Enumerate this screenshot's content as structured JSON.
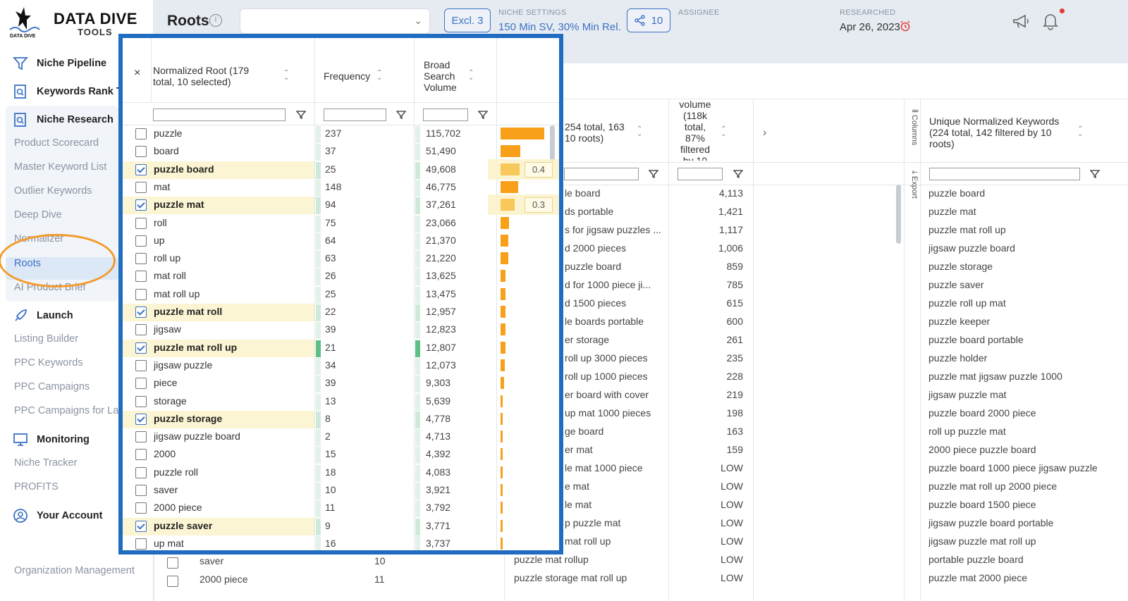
{
  "sidebar": {
    "logo_title": "DATA DIVE",
    "logo_sub": "TOOLS",
    "logo_mark": "DATA DIVE",
    "niche_pipeline": "Niche Pipeline",
    "keywords_rank": "Keywords Rank Tracker",
    "niche_research": "Niche Research",
    "research_items": [
      "Product Scorecard",
      "Master Keyword List",
      "Outlier Keywords",
      "Deep Dive",
      "Normalizer",
      "Roots",
      "AI Product Brief"
    ],
    "launch": "Launch",
    "launch_items": [
      "Listing Builder",
      "PPC Keywords",
      "PPC Campaigns",
      "PPC Campaigns for Launch"
    ],
    "monitoring": "Monitoring",
    "monitoring_items": [
      "Niche Tracker",
      "PROFITS"
    ],
    "account": "Your Account",
    "org": "Organization Management"
  },
  "topbar": {
    "title": "Roots",
    "excl": "Excl. 3",
    "niche_label": "NICHE SETTINGS",
    "niche_value": "150 Min SV, 30% Min Rel.",
    "share": "10",
    "assignee_label": "ASSIGNEE",
    "researched_label": "RESEARCHED",
    "researched_value": "Apr 26, 2023"
  },
  "colors": {
    "accent": "#3b72c4",
    "highlight": "#1f6cc0",
    "orange": "#f39a2b",
    "bar": "#f9a01b"
  },
  "kw_table": {
    "kw_header": "254 total, 163",
    "kw_header2": "10 roots)",
    "vol_header": [
      "volume",
      "(118k",
      "total,",
      "87%",
      "filtered",
      "by 10"
    ],
    "uniq_header": [
      "Unique Normalized Keywords",
      "(224 total, 142 filtered by 10",
      "roots)"
    ],
    "columns_label": "Columns",
    "export_label": "Export",
    "rows": [
      {
        "kw": "le board",
        "vol": "4,113",
        "u": "puzzle board"
      },
      {
        "kw": "ds portable",
        "vol": "1,421",
        "u": "puzzle mat"
      },
      {
        "kw": "s for jigsaw puzzles ...",
        "vol": "1,117",
        "u": "puzzle mat roll up"
      },
      {
        "kw": "d 2000 pieces",
        "vol": "1,006",
        "u": "jigsaw puzzle board"
      },
      {
        "kw": "puzzle board",
        "vol": "859",
        "u": "puzzle storage"
      },
      {
        "kw": "d for 1000 piece ji...",
        "vol": "785",
        "u": "puzzle saver"
      },
      {
        "kw": "d 1500 pieces",
        "vol": "615",
        "u": "puzzle roll up mat"
      },
      {
        "kw": "le boards portable",
        "vol": "600",
        "u": "puzzle keeper"
      },
      {
        "kw": "er storage",
        "vol": "261",
        "u": "puzzle board portable"
      },
      {
        "kw": "roll up 3000 pieces",
        "vol": "235",
        "u": "puzzle holder"
      },
      {
        "kw": "roll up 1000 pieces",
        "vol": "228",
        "u": "puzzle mat jigsaw puzzle 1000"
      },
      {
        "kw": "er board with cover",
        "vol": "219",
        "u": "jigsaw puzzle mat"
      },
      {
        "kw": "up mat 1000 pieces",
        "vol": "198",
        "u": "puzzle board 2000 piece"
      },
      {
        "kw": "ge board",
        "vol": "163",
        "u": "roll up puzzle mat"
      },
      {
        "kw": "er mat",
        "vol": "159",
        "u": "2000 piece puzzle board"
      },
      {
        "kw": "le mat 1000 piece",
        "vol": "LOW",
        "u": "puzzle board 1000 piece jigsaw puzzle"
      },
      {
        "kw": "e mat",
        "vol": "LOW",
        "u": "puzzle mat roll up 2000 piece"
      },
      {
        "kw": "le mat",
        "vol": "LOW",
        "u": "puzzle board 1500 piece"
      },
      {
        "kw": "p puzzle mat",
        "vol": "LOW",
        "u": "jigsaw puzzle board portable"
      },
      {
        "kw": "mat roll up",
        "vol": "LOW",
        "u": "jigsaw puzzle mat roll up"
      },
      {
        "kw": "puzzle mat rollup",
        "vol": "LOW",
        "u": "portable puzzle board"
      },
      {
        "kw": "puzzle storage mat roll up",
        "vol": "LOW",
        "u": "puzzle mat 2000 piece"
      }
    ],
    "under_rows": [
      {
        "root": "saver",
        "freq": "10"
      },
      {
        "root": "2000 piece",
        "freq": "11"
      }
    ]
  },
  "roots_table": {
    "close": "×",
    "h_root": "Normalized Root (179",
    "h_root2": "total, 10 selected)",
    "h_freq": "Frequency",
    "h_sv": [
      "Broad",
      "Search",
      "Volume"
    ],
    "rows": [
      {
        "root": "puzzle",
        "freq": "237",
        "sv": "115,702",
        "sel": false,
        "bar": 1.0
      },
      {
        "root": "board",
        "freq": "37",
        "sv": "51,490",
        "sel": false,
        "bar": 0.445
      },
      {
        "root": "puzzle board",
        "freq": "25",
        "sv": "49,608",
        "sel": true,
        "bar": 0.429,
        "tip": "0.4"
      },
      {
        "root": "mat",
        "freq": "148",
        "sv": "46,775",
        "sel": false,
        "bar": 0.404
      },
      {
        "root": "puzzle mat",
        "freq": "94",
        "sv": "37,261",
        "sel": true,
        "bar": 0.322,
        "tip": "0.3"
      },
      {
        "root": "roll",
        "freq": "75",
        "sv": "23,066",
        "sel": false,
        "bar": 0.199
      },
      {
        "root": "up",
        "freq": "64",
        "sv": "21,370",
        "sel": false,
        "bar": 0.185
      },
      {
        "root": "roll up",
        "freq": "63",
        "sv": "21,220",
        "sel": false,
        "bar": 0.183
      },
      {
        "root": "mat roll",
        "freq": "26",
        "sv": "13,625",
        "sel": false,
        "bar": 0.118
      },
      {
        "root": "mat roll up",
        "freq": "25",
        "sv": "13,475",
        "sel": false,
        "bar": 0.116
      },
      {
        "root": "puzzle mat roll",
        "freq": "22",
        "sv": "12,957",
        "sel": true,
        "bar": 0.112
      },
      {
        "root": "jigsaw",
        "freq": "39",
        "sv": "12,823",
        "sel": false,
        "bar": 0.111
      },
      {
        "root": "puzzle mat roll up",
        "freq": "21",
        "sv": "12,807",
        "sel": true,
        "bar": 0.111
      },
      {
        "root": "jigsaw puzzle",
        "freq": "34",
        "sv": "12,073",
        "sel": false,
        "bar": 0.104
      },
      {
        "root": "piece",
        "freq": "39",
        "sv": "9,303",
        "sel": false,
        "bar": 0.08
      },
      {
        "root": "storage",
        "freq": "13",
        "sv": "5,639",
        "sel": false,
        "bar": 0.049
      },
      {
        "root": "puzzle storage",
        "freq": "8",
        "sv": "4,778",
        "sel": true,
        "bar": 0.041
      },
      {
        "root": "jigsaw puzzle board",
        "freq": "2",
        "sv": "4,713",
        "sel": false,
        "bar": 0.041
      },
      {
        "root": "2000",
        "freq": "15",
        "sv": "4,392",
        "sel": false,
        "bar": 0.038
      },
      {
        "root": "puzzle roll",
        "freq": "18",
        "sv": "4,083",
        "sel": false,
        "bar": 0.035
      },
      {
        "root": "saver",
        "freq": "10",
        "sv": "3,921",
        "sel": false,
        "bar": 0.034
      },
      {
        "root": "2000 piece",
        "freq": "11",
        "sv": "3,792",
        "sel": false,
        "bar": 0.033
      },
      {
        "root": "puzzle saver",
        "freq": "9",
        "sv": "3,771",
        "sel": true,
        "bar": 0.033
      },
      {
        "root": "up mat",
        "freq": "16",
        "sv": "3,737",
        "sel": false,
        "bar": 0.032
      }
    ]
  }
}
